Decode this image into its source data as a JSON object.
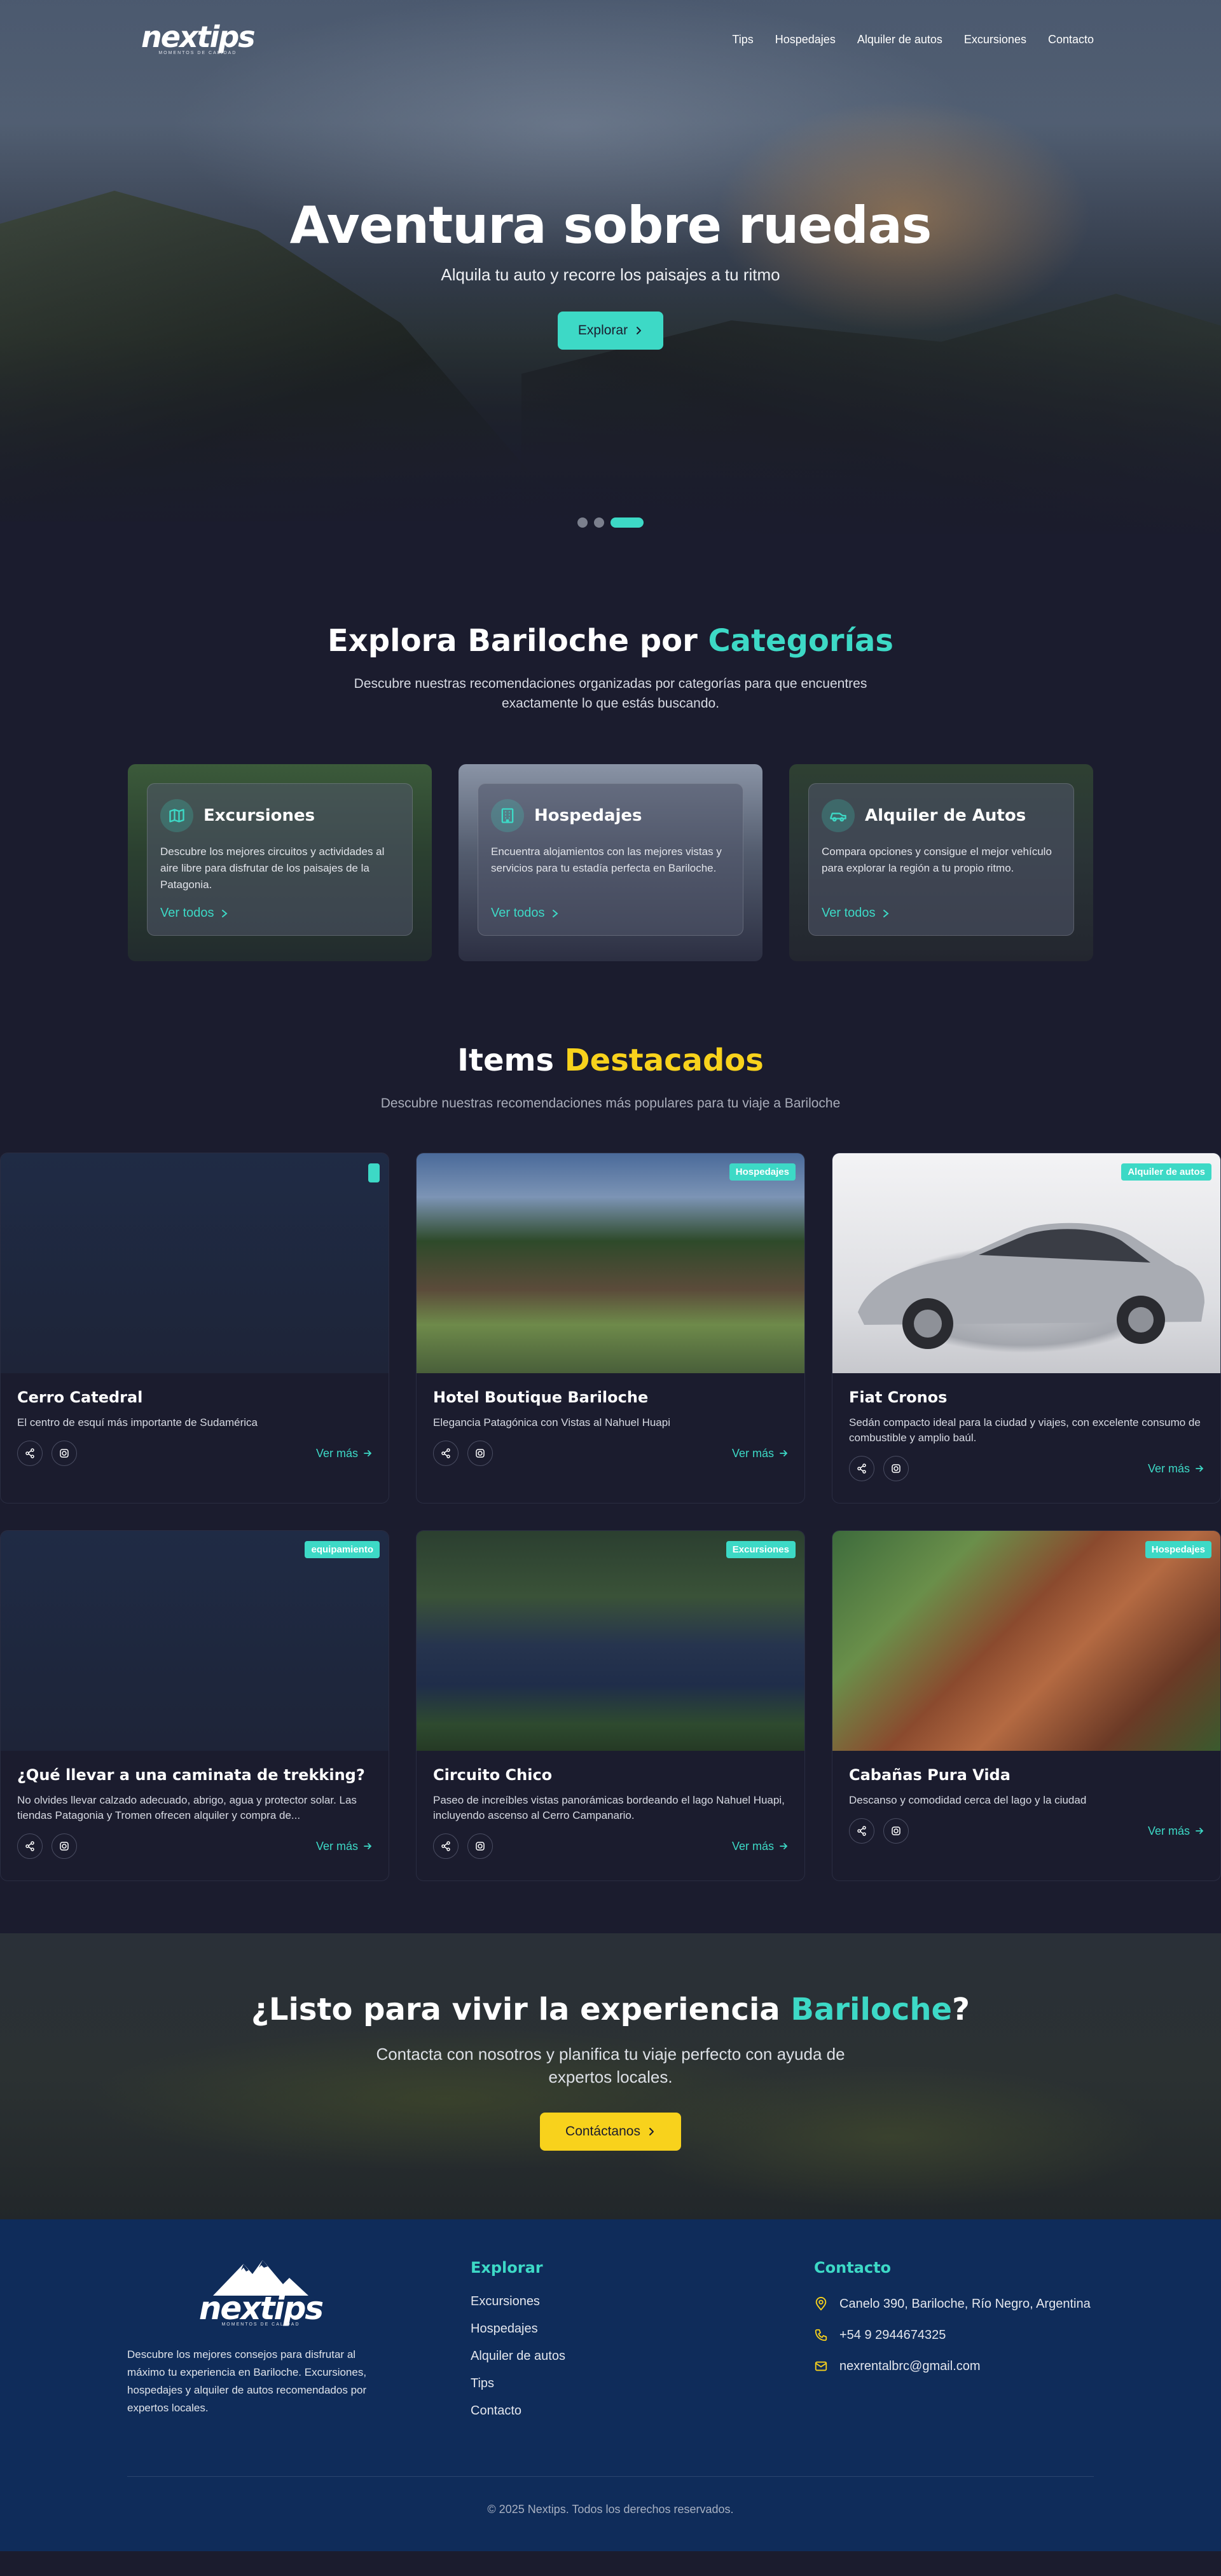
{
  "nav": {
    "logo_text": "nextips",
    "logo_sub": "MOMENTOS DE CALIDAD",
    "links": [
      "Tips",
      "Hospedajes",
      "Alquiler de autos",
      "Excursiones",
      "Contacto"
    ]
  },
  "hero": {
    "title": "Aventura sobre ruedas",
    "subtitle": "Alquila tu auto y recorre los paisajes a tu ritmo",
    "button": "Explorar",
    "slides": 3,
    "active_slide": 3
  },
  "categories": {
    "title_prefix": "Explora Bariloche por ",
    "title_highlight": "Categorías",
    "description": "Descubre nuestras recomendaciones organizadas por categorías para que encuentres exactamente lo que estás buscando.",
    "cards": [
      {
        "name": "Excursiones",
        "icon": "map-icon",
        "description": "Descubre los mejores circuitos y actividades al aire libre para disfrutar de los paisajes de la Patagonia.",
        "link": "Ver todos"
      },
      {
        "name": "Hospedajes",
        "icon": "building-icon",
        "description": "Encuentra alojamientos con las mejores vistas y servicios para tu estadía perfecta en Bariloche.",
        "link": "Ver todos"
      },
      {
        "name": "Alquiler de Autos",
        "icon": "car-icon",
        "description": "Compara opciones y consigue el mejor vehículo para explorar la región a tu propio ritmo.",
        "link": "Ver todos"
      }
    ]
  },
  "featured": {
    "title_prefix": "Items ",
    "title_highlight": "Destacados",
    "description": "Descubre nuestras recomendaciones más populares para tu viaje a Bariloche",
    "link_label": "Ver más",
    "items": [
      {
        "title": "Cerro Catedral",
        "description": "El centro de esquí más importante de Sudamérica",
        "badge": ""
      },
      {
        "title": "Hotel Boutique Bariloche",
        "description": "Elegancia Patagónica con Vistas al Nahuel Huapi",
        "badge": "Hospedajes"
      },
      {
        "title": "Fiat Cronos",
        "description": "Sedán compacto ideal para la ciudad y viajes, con excelente consumo de combustible y amplio baúl.",
        "badge": "Alquiler de autos"
      },
      {
        "title": "¿Qué llevar a una caminata de trekking?",
        "description": "No olvides llevar calzado adecuado, abrigo, agua y protector solar. Las tiendas Patagonia y Tromen ofrecen alquiler y compra de...",
        "badge": "equipamiento"
      },
      {
        "title": "Circuito Chico",
        "description": "Paseo de increíbles vistas panorámicas bordeando el lago Nahuel Huapi, incluyendo ascenso al Cerro Campanario.",
        "badge": "Excursiones"
      },
      {
        "title": "Cabañas Pura Vida",
        "description": "Descanso y comodidad cerca del lago y la ciudad",
        "badge": "Hospedajes"
      }
    ]
  },
  "cta": {
    "title_prefix": "¿Listo para vivir la experiencia ",
    "title_highlight": "Bariloche",
    "title_suffix": "?",
    "description": "Contacta con nosotros y planifica tu viaje perfecto con ayuda de expertos locales.",
    "button": "Contáctanos"
  },
  "footer": {
    "about": "Descubre los mejores consejos para disfrutar al máximo tu experiencia en Bariloche. Excursiones, hospedajes y alquiler de autos recomendados por expertos locales.",
    "explore_heading": "Explorar",
    "explore_links": [
      "Excursiones",
      "Hospedajes",
      "Alquiler de autos",
      "Tips",
      "Contacto"
    ],
    "contact_heading": "Contacto",
    "address": "Canelo 390, Bariloche, Río Negro, Argentina",
    "phone": "+54 9 2944674325",
    "email": "nexrentalbrc@gmail.com",
    "copyright": "© 2025 Nextips. Todos los derechos reservados."
  },
  "colors": {
    "background": "#1b1c2e",
    "accent_teal": "#3dd9c6",
    "accent_yellow": "#f8d21c",
    "footer": "#0f2c5a"
  }
}
